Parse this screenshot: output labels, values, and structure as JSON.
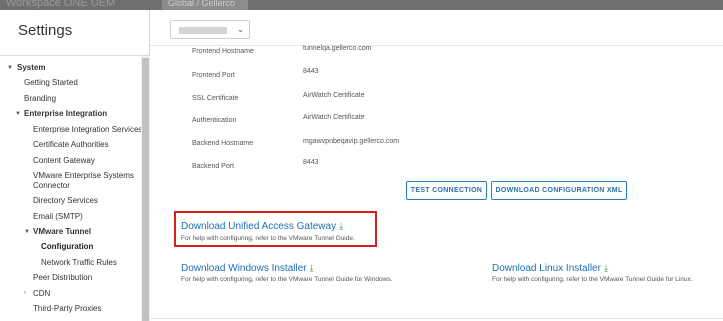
{
  "top": {
    "workspace_title": "Workspace ONE UEM",
    "org_tab": "Global / Gellerco"
  },
  "sidebar": {
    "title": "Settings",
    "items": [
      {
        "label": "System",
        "level": 0,
        "bold": true,
        "caret": "expanded"
      },
      {
        "label": "Getting Started",
        "level": 1
      },
      {
        "label": "Branding",
        "level": 1
      },
      {
        "label": "Enterprise Integration",
        "level": 1,
        "bold": true,
        "caret": "expanded"
      },
      {
        "label": "Enterprise Integration Services",
        "level": 2
      },
      {
        "label": "Certificate Authorities",
        "level": 2
      },
      {
        "label": "Content Gateway",
        "level": 2
      },
      {
        "label": "VMware Enterprise Systems",
        "level": 2
      },
      {
        "label": "Connector",
        "level": 2
      },
      {
        "label": "Directory Services",
        "level": 2
      },
      {
        "label": "Email (SMTP)",
        "level": 2
      },
      {
        "label": "VMware Tunnel",
        "level": 2,
        "bold": true,
        "caret": "expanded"
      },
      {
        "label": "Configuration",
        "level": 3,
        "bold": true
      },
      {
        "label": "Network Traffic Rules",
        "level": 3
      },
      {
        "label": "Peer Distribution",
        "level": 2
      },
      {
        "label": "CDN",
        "level": 2,
        "caret": "collapsed"
      },
      {
        "label": "Third-Party Proxies",
        "level": 2
      }
    ]
  },
  "fields": [
    {
      "label": "Frontend Hostname",
      "value": "tunnelqa.gellerco.com"
    },
    {
      "label": "Frontend Port",
      "value": "8443"
    },
    {
      "label": "SSL Certificate",
      "value": "AirWatch Certificate"
    },
    {
      "label": "Authentication",
      "value": "AirWatch Certificate"
    },
    {
      "label": "Backend Hostname",
      "value": "mgawvpnbeqavip.gellerco.com"
    },
    {
      "label": "Backend Port",
      "value": "8443"
    }
  ],
  "buttons": {
    "test_connection": "TEST CONNECTION",
    "download_config": "DOWNLOAD CONFIGURATION XML"
  },
  "downloads": {
    "uag": {
      "title": "Download Unified Access Gateway",
      "help": "For help with configuring, refer to the VMware Tunnel Guide."
    },
    "windows": {
      "title": "Download Windows Installer",
      "help": "For help with configuring, refer to the VMware Tunnel Guide for Windows."
    },
    "linux": {
      "title": "Download Linux Installer",
      "help": "For help with configuring, refer to the VMware Tunnel Guide for Linux."
    }
  },
  "colors": {
    "link": "#1f6fb2",
    "download_icon": "#2e9b3e",
    "highlight": "#d91e1e",
    "button_border": "#2f7fbf"
  },
  "icons": {
    "download": "download-arrow-icon",
    "chevron": "chevron-down-icon"
  }
}
